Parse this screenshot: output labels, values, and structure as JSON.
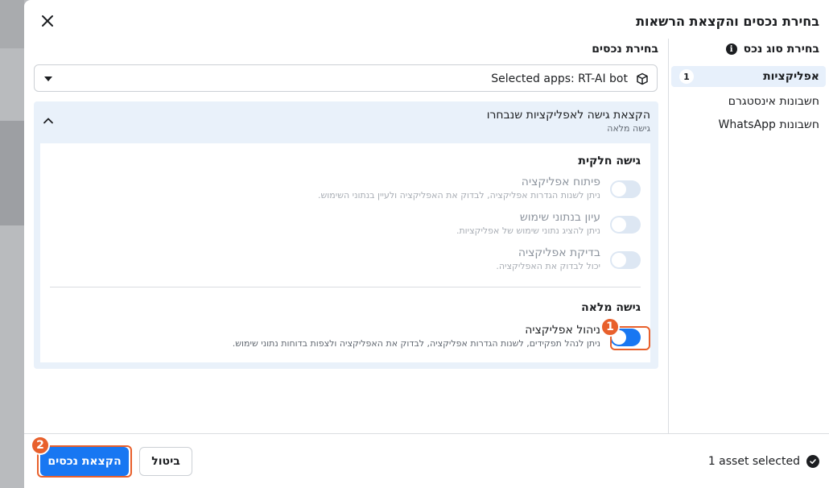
{
  "dialog": {
    "title": "בחירת נכסים והקצאת הרשאות",
    "close_icon": "close-icon"
  },
  "sidebar": {
    "heading": "בחירת סוג נכס",
    "info_icon": "info-icon",
    "info_glyph": "i",
    "items": [
      {
        "label": "אפליקציות",
        "count": "1",
        "active": true
      },
      {
        "label": "חשבונות אינסטגרם"
      },
      {
        "label": "חשבונות WhatsApp"
      }
    ]
  },
  "main": {
    "heading": "בחירת נכסים",
    "selector": {
      "value": "Selected apps: RT-AI bot",
      "icon": "cube-icon"
    },
    "panel": {
      "title": "הקצאת גישה לאפליקציות שנבחרו",
      "subtitle": "גישה מלאה",
      "partial": {
        "title": "גישה חלקית",
        "items": [
          {
            "label": "פיתוח אפליקציה",
            "desc": "ניתן לשנות הגדרות אפליקציה, לבדוק את האפליקציה ולעיין בנתוני השימוש."
          },
          {
            "label": "עיון בנתוני שימוש",
            "desc": "ניתן להציג נתוני שימוש של אפליקציות."
          },
          {
            "label": "בדיקת אפליקציה",
            "desc": "יכול לבדוק את האפליקציה."
          }
        ]
      },
      "full": {
        "title": "גישה מלאה",
        "item": {
          "label": "ניהול אפליקציה",
          "desc": "ניתן לנהל תפקידים, לשנות הגדרות אפליקציה, לבדוק את האפליקציה ולצפות בדוחות נתוני שימוש."
        }
      }
    }
  },
  "annotations": {
    "step1": "1",
    "step2": "2",
    "color": "#e8602c"
  },
  "footer": {
    "status": "1 asset selected",
    "cancel_label": "ביטול",
    "primary_label": "הקצאת נכסים"
  },
  "colors": {
    "accent": "#1877f2",
    "panel_bg": "#e9f1fa",
    "annotation": "#e8602c"
  }
}
